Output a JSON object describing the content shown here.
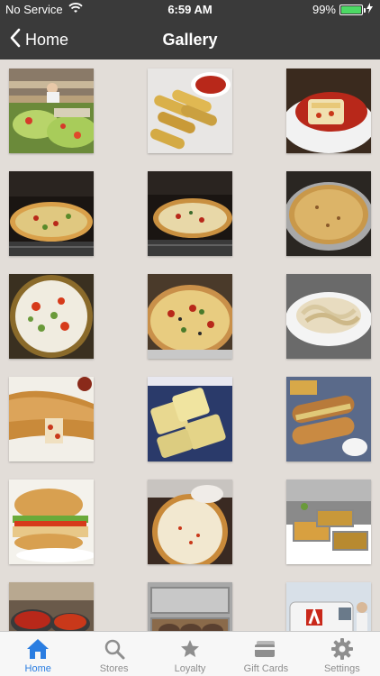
{
  "status_bar": {
    "carrier": "No Service",
    "time": "6:59 AM",
    "battery_percent": "99%",
    "battery_level": 0.99
  },
  "nav": {
    "back_label": "Home",
    "title": "Gallery"
  },
  "gallery": {
    "photos": [
      {
        "subject": "salad bar"
      },
      {
        "subject": "mozzarella sticks with marinara"
      },
      {
        "subject": "lasagna"
      },
      {
        "subject": "pizza in oven"
      },
      {
        "subject": "pizza in oven"
      },
      {
        "subject": "baked pizza"
      },
      {
        "subject": "pizza with toppings"
      },
      {
        "subject": "supreme pizza"
      },
      {
        "subject": "pasta alfredo"
      },
      {
        "subject": "stromboli"
      },
      {
        "subject": "garlic cheese bread"
      },
      {
        "subject": "sub sandwiches with fries"
      },
      {
        "subject": "chicken sandwich"
      },
      {
        "subject": "cheese pizza being made"
      },
      {
        "subject": "catering buffet"
      },
      {
        "subject": "sauce pots in kitchen"
      },
      {
        "subject": "catering trays"
      },
      {
        "subject": "delivery van"
      }
    ]
  },
  "tabs": [
    {
      "label": "Home",
      "icon": "home-icon",
      "active": true
    },
    {
      "label": "Stores",
      "icon": "search-icon",
      "active": false
    },
    {
      "label": "Loyalty",
      "icon": "star-icon",
      "active": false
    },
    {
      "label": "Gift Cards",
      "icon": "gift-card-icon",
      "active": false
    },
    {
      "label": "Settings",
      "icon": "gear-icon",
      "active": false
    }
  ],
  "colors": {
    "bar_dark": "#3a3a3a",
    "background": "#e2ddd8",
    "tab_active": "#2a7de1",
    "tab_inactive": "#8e8e8e"
  }
}
